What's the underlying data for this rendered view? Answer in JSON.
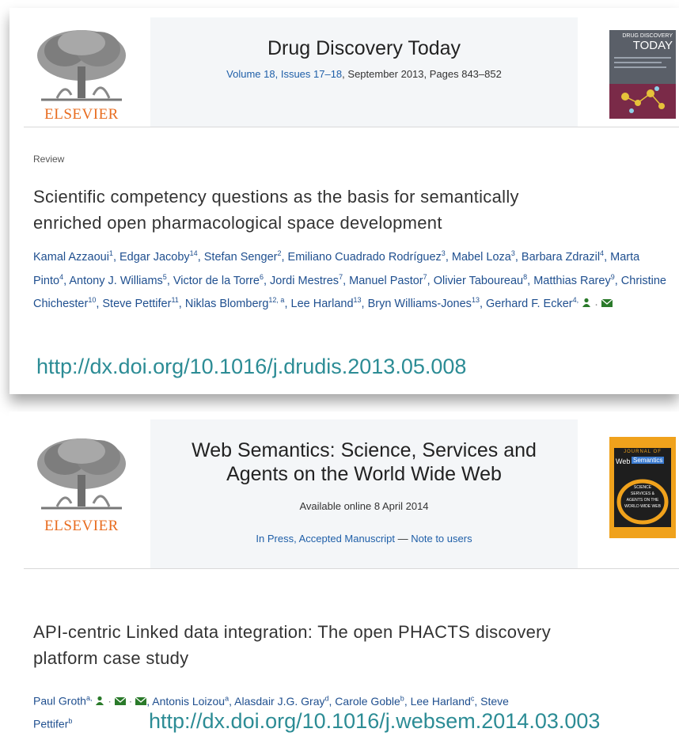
{
  "card1": {
    "publisher": "ELSEVIER",
    "journal": "Drug Discovery Today",
    "volume_link": "Volume 18, Issues 17–18",
    "volume_rest": ", September 2013, Pages 843–852",
    "cover": {
      "line1": "DRUG DISCOVERY",
      "line2": "TODAY"
    },
    "label": "Review",
    "title_line1": "Scientific competency questions as the basis for semantically",
    "title_line2": "enriched open pharmacological space development",
    "authors": [
      {
        "name": "Kamal Azzaoui",
        "sup": "1"
      },
      {
        "name": "Edgar Jacoby",
        "sup": "14"
      },
      {
        "name": "Stefan Senger",
        "sup": "2"
      },
      {
        "name": "Emiliano Cuadrado Rodríguez",
        "sup": "3"
      },
      {
        "name": "Mabel Loza",
        "sup": "3"
      },
      {
        "name": "Barbara Zdrazil",
        "sup": "4"
      },
      {
        "name": "Marta Pinto",
        "sup": "4"
      },
      {
        "name": "Antony J. Williams",
        "sup": "5"
      },
      {
        "name": "Victor de la Torre",
        "sup": "6"
      },
      {
        "name": "Jordi Mestres",
        "sup": "7"
      },
      {
        "name": "Manuel Pastor",
        "sup": "7"
      },
      {
        "name": "Olivier Taboureau",
        "sup": "8"
      },
      {
        "name": "Matthias Rarey",
        "sup": "9"
      },
      {
        "name": "Christine Chichester",
        "sup": "10"
      },
      {
        "name": "Steve Pettifer",
        "sup": "11"
      },
      {
        "name": "Niklas Blomberg",
        "sup": "12, a"
      },
      {
        "name": "Lee Harland",
        "sup": "13"
      },
      {
        "name": "Bryn Williams-Jones",
        "sup": "13"
      },
      {
        "name": "Gerhard F. Ecker",
        "sup": "4,"
      }
    ],
    "doi": "http://dx.doi.org/10.1016/j.drudis.2013.05.008"
  },
  "card2": {
    "publisher": "ELSEVIER",
    "journal_line1": "Web Semantics: Science, Services and",
    "journal_line2": "Agents on the World Wide Web",
    "available": "Available online 8 April 2014",
    "in_press": "In Press, Accepted Manuscript",
    "dash": " — ",
    "note": "Note to users",
    "cover": {
      "header": "JOURNAL OF",
      "word1": "Web",
      "word2": "Semantics",
      "sub1": "SCIENCE",
      "sub2": "SERVICES &",
      "sub3": "AGENTS ON THE",
      "sub4": "WORLD WIDE WEB"
    },
    "title_line1": "API-centric Linked data integration: The open PHACTS discovery",
    "title_line2": "platform case study",
    "authors_line1_pre": "Paul Groth",
    "authors_line1_sup": "a,",
    "authors_line1_rest": [
      {
        "name": ", Antonis Loizou",
        "sup": "a"
      },
      {
        "name": ", Alasdair J.G. Gray",
        "sup": "d"
      },
      {
        "name": ", Carole Goble",
        "sup": "b"
      },
      {
        "name": ", Lee Harland",
        "sup": "c"
      },
      {
        "name": ", Steve",
        "sup": ""
      }
    ],
    "authors_line2": "Pettifer",
    "authors_line2_sup": "b",
    "doi": "http://dx.doi.org/10.1016/j.websem.2014.03.003"
  },
  "colors": {
    "link": "#1f5fa8",
    "doi": "#2c8c95",
    "elsevier": "#e86c1f"
  }
}
